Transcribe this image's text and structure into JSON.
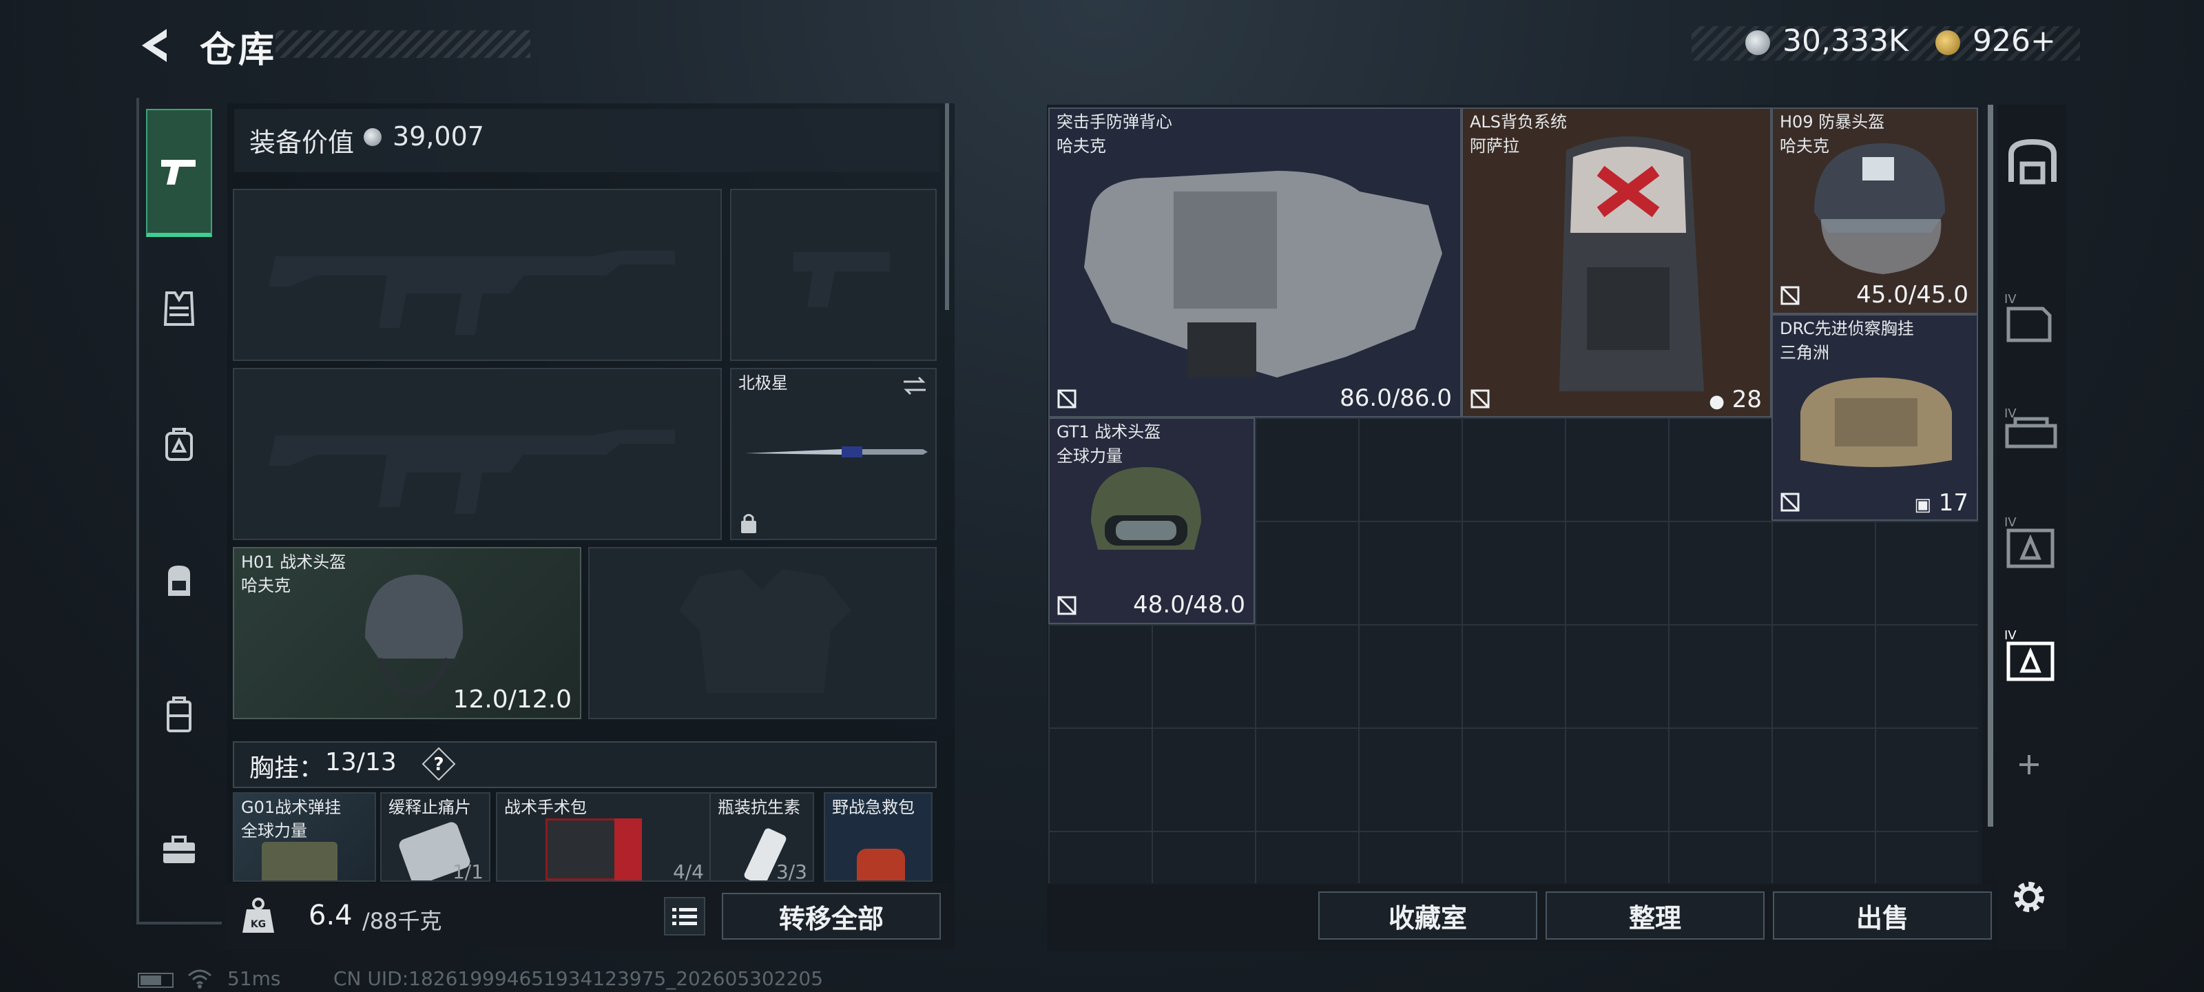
{
  "header": {
    "title": "仓库"
  },
  "currency": {
    "money": "30,333K",
    "bonds": "926",
    "bonds_add": "+"
  },
  "equipment": {
    "value_label": "装备价值",
    "value": "39,007",
    "melee": {
      "name": "北极星"
    },
    "helmet": {
      "name": "H01 战术头盔",
      "brand": "哈夫克",
      "durability": "12.0/12.0"
    },
    "chest_rig": {
      "label": "胸挂：",
      "count": "13/13",
      "help": "?"
    },
    "pouches": [
      {
        "name": "G01战术弹挂",
        "brand": "全球力量",
        "count": ""
      },
      {
        "name": "缓释止痛片",
        "count": "1/1"
      },
      {
        "name": "战术手术包",
        "count": "4/4"
      },
      {
        "name": "瓶装抗生素",
        "count": "3/3"
      },
      {
        "name": "野战急救包",
        "count": ""
      }
    ]
  },
  "weight": {
    "current": "6.4",
    "max": "/88千克"
  },
  "buttons": {
    "transfer_all": "转移全部",
    "collection": "收藏室",
    "sort": "整理",
    "sell": "出售"
  },
  "stash_items": {
    "vest": {
      "name": "突击手防弹背心",
      "brand": "哈夫克",
      "durability": "86.0/86.0"
    },
    "backpack": {
      "name": "ALS背负系统",
      "brand": "阿萨拉",
      "capacity": "28"
    },
    "helmet": {
      "name": "H09 防暴头盔",
      "brand": "哈夫克",
      "durability": "45.0/45.0"
    },
    "rig": {
      "name": "DRC先进侦察胸挂",
      "brand": "三角洲",
      "capacity": "17"
    },
    "gt1": {
      "name": "GT1 战术头盔",
      "brand": "全球力量",
      "durability": "48.0/48.0"
    }
  },
  "status": {
    "ping": "51ms",
    "uid": "CN UID:1826199946519341239​75_202605302205"
  },
  "colors": {
    "accent_green": "#3ecf96",
    "coin_gold": "#d9a838",
    "coin_silver": "#c6ccd1"
  }
}
